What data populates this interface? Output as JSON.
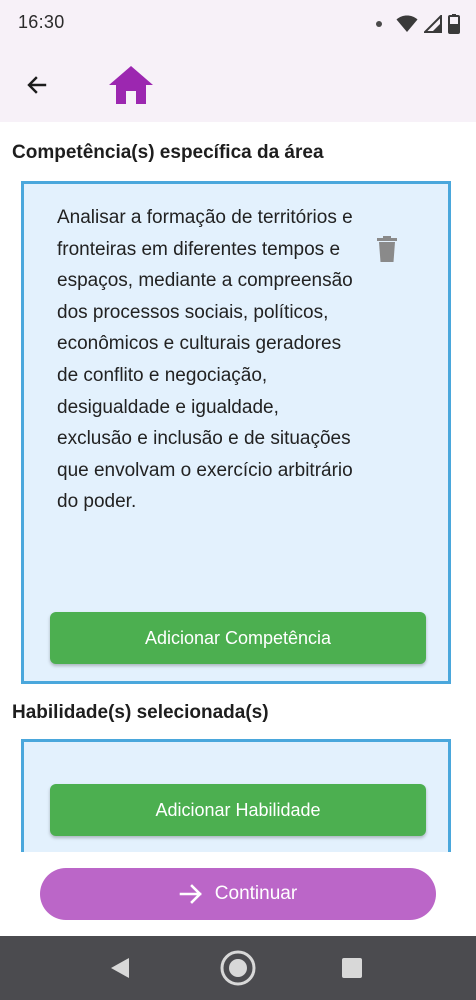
{
  "status_bar": {
    "time": "16:30"
  },
  "app_bar": {
    "back_icon": "arrow-left-icon",
    "home_icon": "home-icon",
    "home_color": "#9c27b0"
  },
  "sections": {
    "competence_title": "Competência(s) específica da área",
    "skills_title": "Habilidade(s) selecionada(s)"
  },
  "competence_card": {
    "text": "Analisar a formação de territórios e fronteiras em diferentes tempos e espaços, mediante a compreensão dos processos sociais, políticos, econômicos e culturais geradores de conflito e negociação, desigualdade e igualdade, exclusão e inclusão e de situações que envolvam o exercício arbitrário do poder.",
    "delete_icon": "trash-icon",
    "add_button_label": "Adicionar Competência"
  },
  "skills_card": {
    "add_button_label": "Adicionar Habilidade"
  },
  "footer": {
    "continue_label": "Continuar",
    "continue_icon": "arrow-right-icon"
  },
  "colors": {
    "accent_purple": "#bb66c8",
    "button_green": "#4caf50",
    "card_background": "#e3f1fd",
    "card_border": "#4aa7dc"
  }
}
